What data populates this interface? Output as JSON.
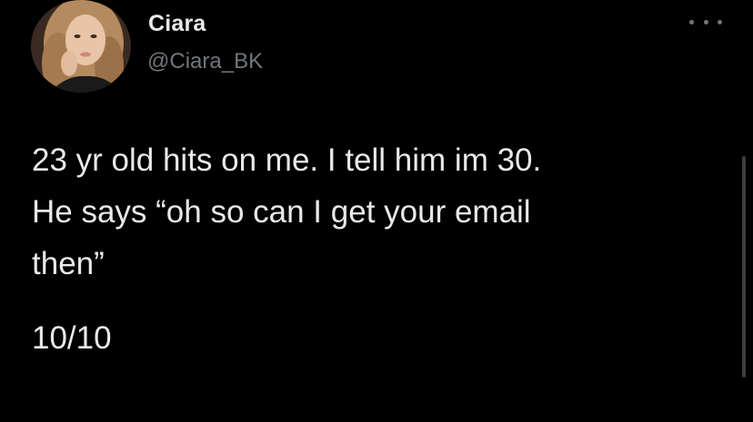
{
  "author": {
    "display_name": "Ciara",
    "handle": "@Ciara_BK",
    "avatar_icon": "profile-photo"
  },
  "menu": {
    "icon": "more-dots-icon"
  },
  "tweet": {
    "lines": [
      "23 yr old hits on me. I tell him im 30.",
      "He says “oh so can I get your email",
      "then”"
    ],
    "score": "10/10"
  },
  "colors": {
    "background": "#000000",
    "primary_text": "#e7e9ea",
    "secondary_text": "#71767b"
  }
}
